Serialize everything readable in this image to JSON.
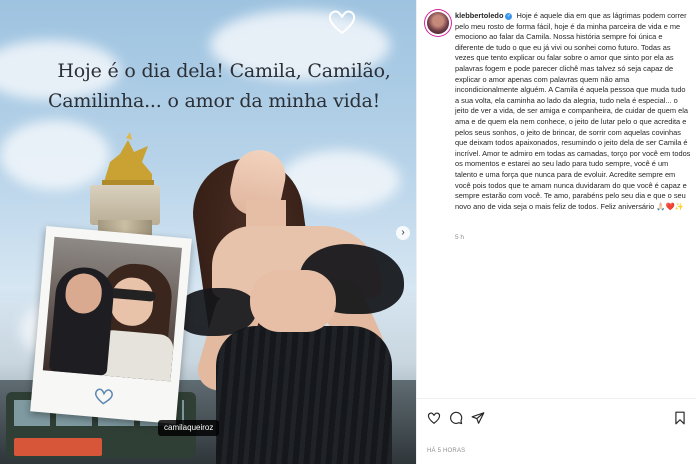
{
  "post": {
    "headline_line1": "Hoje é o dia dela! Camila, Camilão,",
    "headline_line2": "Camilinha... o amor da minha vida!",
    "tagged_user": "camilaqueiroz",
    "carousel_next_icon": "›"
  },
  "caption": {
    "username": "klebbertoledo",
    "verified_icon": "✓",
    "text": "Hoje é aquele dia em que as lágrimas podem correr pelo meu rosto de forma fácil, hoje é da minha parceira de vida e me emociono ao falar da Camila. Nossa história sempre foi única e diferente de tudo o que eu já vivi ou sonhei como futuro. Todas as vezes que tento explicar ou falar sobre o amor que sinto por ela as palavras fogem e pode parecer clichê mas talvez só seja capaz de explicar o amor apenas com palavras quem não ama incondicionalmente alguém. A Camila é aquela pessoa que muda tudo a sua volta, ela caminha ao lado da alegria, tudo nela é especial... o jeito de ver a vida, de ser amiga e companheira, de cuidar de quem ela ama e de quem ela nem conhece, o jeito de lutar pelo o que acredita e pelos seus sonhos, o jeito de brincar, de sorrir com aquelas covinhas que deixam todos apaixonados, resumindo o jeito dela de ser Camila é incrível. Amor te admiro em todas as camadas, torço por você em todos os momentos e estarei ao seu lado para tudo sempre, você é um talento e uma força que nunca para de evoluir. Acredite sempre em você pois todos que te amam nunca duvidaram do que você é capaz e sempre estarão com você. Te amo, parabéns pelo seu dia e que o seu novo ano de vida seja o mais feliz de todos. Feliz aniversário 🙏🏻❤️✨",
    "time_ago": "5 h"
  },
  "actions": {
    "like_icon": "heart-icon",
    "comment_icon": "comment-icon",
    "share_icon": "share-icon",
    "save_icon": "bookmark-icon"
  },
  "footer": {
    "post_time": "HÁ 5 HORAS"
  },
  "colors": {
    "text": "#262626",
    "muted": "#8e8e8e",
    "verified": "#3897f0",
    "story_ring": "#d6249f"
  }
}
